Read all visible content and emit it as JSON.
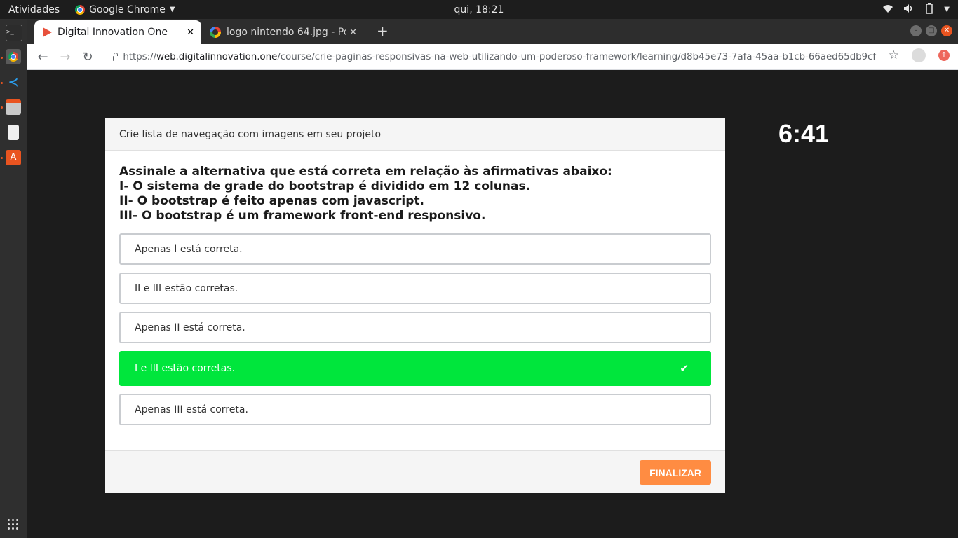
{
  "topbar": {
    "activities": "Atividades",
    "app_menu": "Google Chrome",
    "clock": "qui, 18:21"
  },
  "tabs": [
    {
      "title": "Digital Innovation One",
      "active": true
    },
    {
      "title": "logo nintendo 64.jpg - Pes",
      "active": false
    }
  ],
  "address": {
    "scheme": "https://",
    "host": "web.digitalinnovation.one",
    "path": "/course/crie-paginas-responsivas-na-web-utilizando-um-poderoso-framework/learning/d8b45e73-7afa-45aa-b1cb-66aed65db9cf"
  },
  "quiz": {
    "header": "Crie lista de navegação com imagens em seu projeto",
    "question_lines": [
      "Assinale a alternativa que está correta em relação às afirmativas abaixo:",
      "I- O sistema de grade do bootstrap é dividido em 12 colunas.",
      "II- O bootstrap é feito apenas com javascript.",
      "III- O bootstrap é um framework front-end responsivo."
    ],
    "options": [
      {
        "text": "Apenas I está correta."
      },
      {
        "text": "II e III estão corretas."
      },
      {
        "text": "Apenas II está correta."
      },
      {
        "text": "I e III estão corretas.",
        "correct": true
      },
      {
        "text": "Apenas III está correta."
      }
    ],
    "finalize_label": "FINALIZAR",
    "timer": "6:41"
  },
  "colors": {
    "correct": "#00e63c",
    "finalize": "#ff8c42"
  }
}
